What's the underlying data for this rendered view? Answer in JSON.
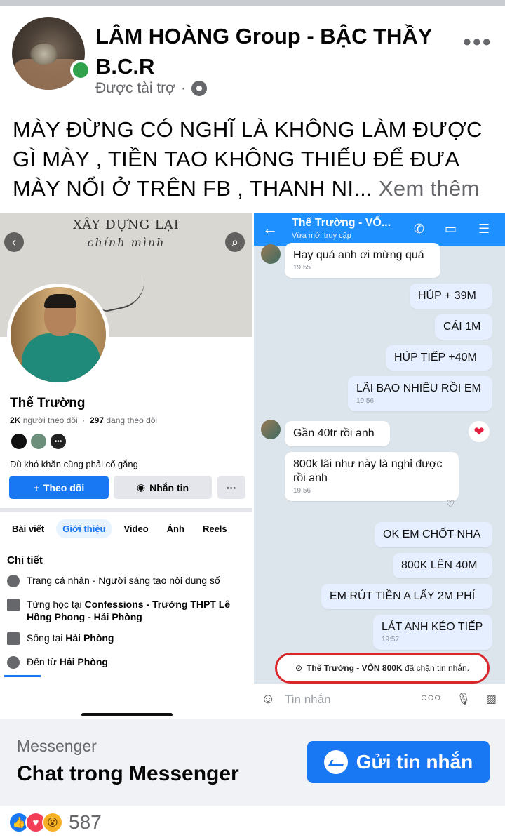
{
  "post": {
    "page_name": "LÂM HOÀNG Group - BẬC THẦY B.C.R",
    "sponsored_label": "Được tài trợ",
    "dot": "·",
    "more_label": "•••",
    "caption": "MÀY ĐỪNG CÓ NGHĨ LÀ KHÔNG LÀM ĐƯỢC GÌ MÀY , TIỀN TAO KHÔNG THIẾU ĐỂ ĐƯA MÀY NỔI Ở TRÊN FB , THANH NI...",
    "see_more": " Xem thêm"
  },
  "profile": {
    "cover_line1": "XÂY DỰNG LẠI",
    "cover_line2": "chính mình",
    "name": "Thế Trường",
    "followers_count": "2K",
    "followers_label": "người theo dõi",
    "following_count": "297",
    "following_label": "đang theo dõi",
    "bio": "Dù khó khăn cũng phải cố gắng",
    "follow_button": "Theo dõi",
    "message_button": "Nhắn tin",
    "more_button": "···",
    "tabs": [
      "Bài viết",
      "Giới thiệu",
      "Video",
      "Ảnh",
      "Reels"
    ],
    "details_title": "Chi tiết",
    "details": [
      {
        "prefix": "Trang cá nhân · ",
        "text": "Người sáng tạo nội dung số"
      },
      {
        "prefix": "Từng học tại ",
        "text": "Confessions - Trường THPT Lê Hồng Phong - Hải Phòng"
      },
      {
        "prefix": "Sống tại ",
        "text": "Hải Phòng"
      },
      {
        "prefix": "Đến từ ",
        "text": "Hải Phòng"
      }
    ]
  },
  "chat": {
    "contact_name": "Thế Trường - VỐ...",
    "status": "Vừa mới truy cập",
    "messages": [
      {
        "side": "left",
        "text": "Hay quá anh ơi mừng quá",
        "time": "19:55"
      },
      {
        "side": "right",
        "text": "HÚP + 39M",
        "time": ""
      },
      {
        "side": "right",
        "text": "CÁI 1M",
        "time": ""
      },
      {
        "side": "right",
        "text": "HÚP TIẾP +40M",
        "time": ""
      },
      {
        "side": "right",
        "text": "LÃI BAO NHIÊU RỒI EM",
        "time": "19:56"
      },
      {
        "side": "left",
        "text": "Gần 40tr rồi anh",
        "time": ""
      },
      {
        "side": "left",
        "text": "800k lãi như này là nghỉ được rồi anh",
        "time": "19:56"
      },
      {
        "side": "right",
        "text": "OK EM CHỐT NHA",
        "time": ""
      },
      {
        "side": "right",
        "text": "800K LÊN 40M",
        "time": ""
      },
      {
        "side": "right",
        "text": "EM RÚT TIỀN A LẤY 2M PHÍ",
        "time": ""
      },
      {
        "side": "right",
        "text": "LÁT ANH KÉO TIẾP",
        "time": "19:57"
      }
    ],
    "blocked_notice_name": "Thế Trường - VỐN 800K",
    "blocked_notice_text": " đã chặn tin nhắn.",
    "composer_placeholder": "Tin nhắn",
    "accent_color": "#1e90ff"
  },
  "cta": {
    "label": "Messenger",
    "title": "Chat trong Messenger",
    "button": "Gửi tin nhắn"
  },
  "reactions": {
    "count": "587",
    "icons": [
      "like-icon",
      "love-icon",
      "wow-icon"
    ]
  }
}
